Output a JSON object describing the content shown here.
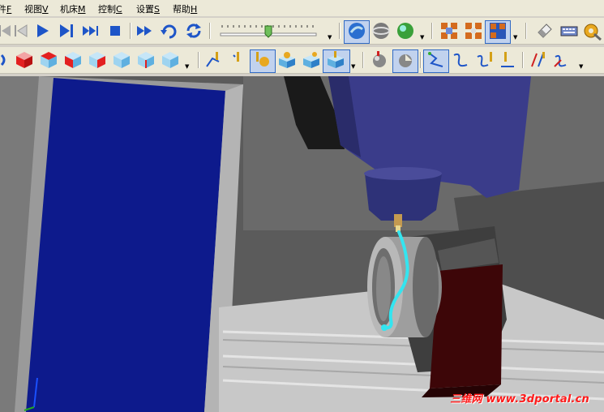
{
  "menu": {
    "items": [
      {
        "name": "menu-file",
        "text": "件",
        "key": "F"
      },
      {
        "name": "menu-view",
        "text": "视图",
        "key": "V"
      },
      {
        "name": "menu-machine",
        "text": "机床",
        "key": "M"
      },
      {
        "name": "menu-control",
        "text": "控制",
        "key": "C"
      },
      {
        "name": "menu-settings",
        "text": "设置",
        "key": "S"
      },
      {
        "name": "menu-help",
        "text": "帮助",
        "key": "H"
      }
    ]
  },
  "watermark": {
    "text": "三维网 www.3dportal.cn"
  },
  "colors": {
    "toolbar_bg": "#ece9d8",
    "fixture_blue": "#0d1a8c",
    "spindle_blue": "#3a3c8a",
    "toolpath_cyan": "#33e5f0",
    "vise_red": "#3d0608",
    "watermark_red": "#ff1a1a"
  },
  "icons": {
    "playback": [
      "rewind-start-icon",
      "play-icon",
      "step-forward-icon",
      "fast-forward-icon",
      "stop-icon",
      "skip-forward-icon",
      "rotate-icon",
      "refresh-icon"
    ],
    "view_cubes": [
      "view-front-icon",
      "view-top-icon",
      "view-right-icon",
      "view-left-icon",
      "view-back-icon",
      "view-bottom-icon",
      "view-iso-icon"
    ],
    "display_modes": [
      "shaded-sphere-icon",
      "wire-sphere-icon",
      "globe-icon"
    ]
  },
  "speed_slider": {
    "level": 0.5
  }
}
